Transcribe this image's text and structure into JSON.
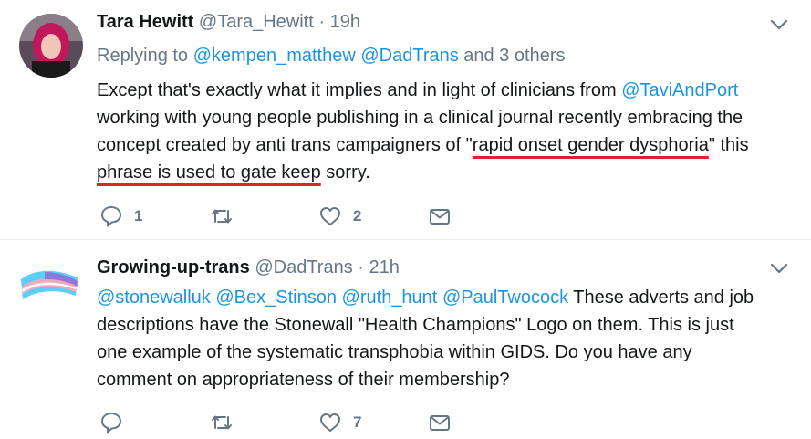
{
  "tweets": [
    {
      "name": "Tara Hewitt",
      "handle": "@Tara_Hewitt",
      "sep": "·",
      "time": "19h",
      "replying": {
        "prefix": "Replying to ",
        "mention1": "@kempen_matthew",
        "mention2": "@DadTrans",
        "suffix": " and 3 others"
      },
      "body": {
        "l1a": "Except that's exactly what it implies and in light of clinicians from ",
        "l1b": "@TaviAndPort",
        "l2": "working with young people publishing in a clinical journal recently embracing the",
        "l3a": "concept created by anti trans campaigners of \"",
        "l3b": "rapid onset gender dysphoria",
        "l3c": "\" this",
        "l4a": "phrase is used to gate keep",
        "l4b": " sorry."
      },
      "replies": "1",
      "retweets": "",
      "likes": "2"
    },
    {
      "name": "Growing-up-trans",
      "handle": "@DadTrans",
      "sep": "·",
      "time": "21h",
      "body": {
        "m1": "@stonewalluk",
        "m2": "@Bex_Stinson",
        "m3": "@ruth_hunt",
        "m4": "@PaulTwocock",
        "l1": " These adverts and job",
        "l2": "descriptions have the Stonewall \"Health Champions\" Logo on them. This is just",
        "l3": "one example of the systematic transphobia within GIDS. Do you have any",
        "l4": "comment on appropriateness of their membership?"
      },
      "replies": "",
      "retweets": "",
      "likes": "7"
    }
  ],
  "colors": {
    "link": "#1b95e0",
    "muted": "#657786",
    "underline_annotation": "#e0202b"
  },
  "icons": [
    "reply-icon",
    "retweet-icon",
    "like-icon",
    "direct-message-icon",
    "chevron-down-icon"
  ]
}
